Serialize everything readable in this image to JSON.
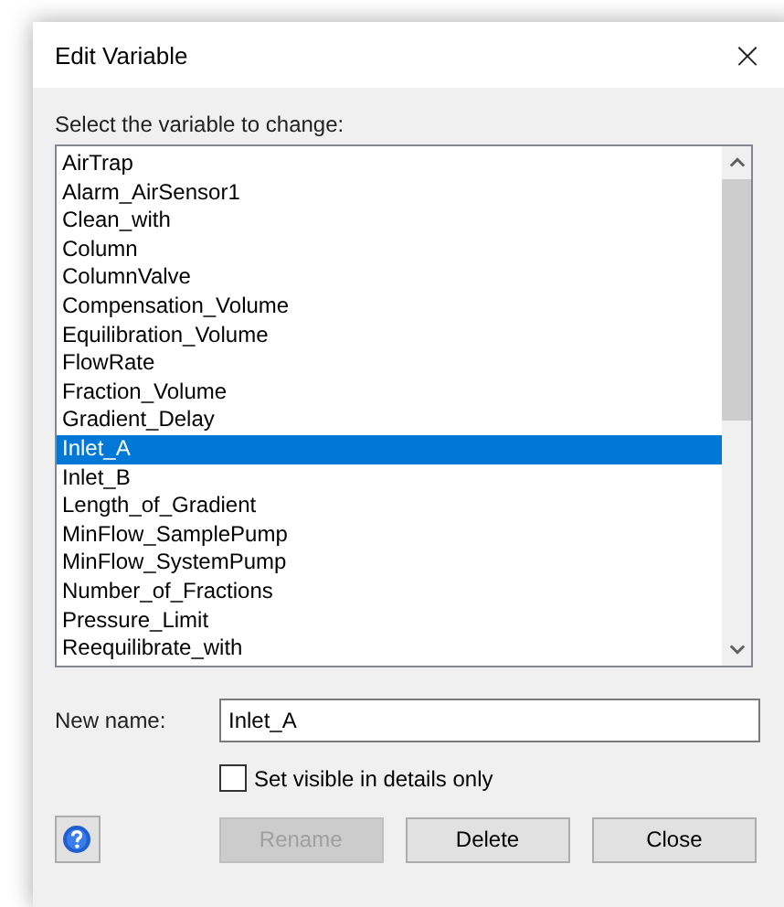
{
  "window": {
    "title": "Edit Variable",
    "close": "×"
  },
  "list_label": "Select the variable to change:",
  "variables": [
    {
      "name": "AirTrap",
      "selected": false
    },
    {
      "name": "Alarm_AirSensor1",
      "selected": false
    },
    {
      "name": "Clean_with",
      "selected": false
    },
    {
      "name": "Column",
      "selected": false
    },
    {
      "name": "ColumnValve",
      "selected": false
    },
    {
      "name": "Compensation_Volume",
      "selected": false
    },
    {
      "name": "Equilibration_Volume",
      "selected": false
    },
    {
      "name": "FlowRate",
      "selected": false
    },
    {
      "name": "Fraction_Volume",
      "selected": false
    },
    {
      "name": "Gradient_Delay",
      "selected": false
    },
    {
      "name": "Inlet_A",
      "selected": true
    },
    {
      "name": "Inlet_B",
      "selected": false
    },
    {
      "name": "Length_of_Gradient",
      "selected": false
    },
    {
      "name": "MinFlow_SamplePump",
      "selected": false
    },
    {
      "name": "MinFlow_SystemPump",
      "selected": false
    },
    {
      "name": "Number_of_Fractions",
      "selected": false
    },
    {
      "name": "Pressure_Limit",
      "selected": false
    },
    {
      "name": "Reequilibrate_with",
      "selected": false
    }
  ],
  "new_name": {
    "label": "New name:",
    "value": "Inlet_A"
  },
  "visible_in_details": {
    "label": "Set visible in details only",
    "checked": false
  },
  "buttons": [
    {
      "label": "Rename",
      "disabled": true
    },
    {
      "label": "Delete",
      "disabled": false
    },
    {
      "label": "Close",
      "disabled": false
    }
  ]
}
